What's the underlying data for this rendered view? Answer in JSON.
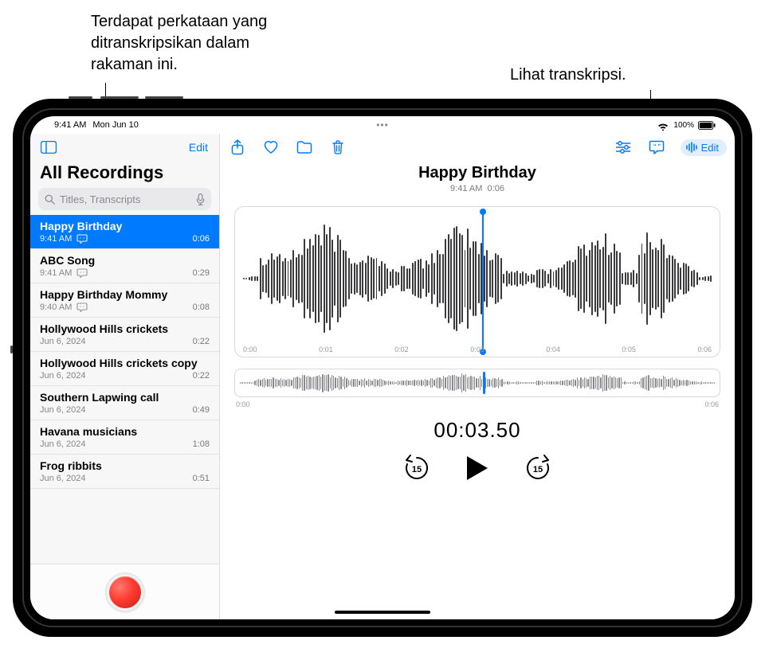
{
  "callouts": {
    "transcript_in_list": "Terdapat perkataan yang ditranskripsikan dalam rakaman ini.",
    "view_transcript": "Lihat transkripsi."
  },
  "status": {
    "time": "9:41 AM",
    "date": "Mon Jun 10"
  },
  "sidebar": {
    "edit": "Edit",
    "title": "All Recordings",
    "search_placeholder": "Titles, Transcripts"
  },
  "recordings": [
    {
      "title": "Happy Birthday",
      "time": "9:41 AM",
      "has_transcript": true,
      "duration": "0:06",
      "selected": true
    },
    {
      "title": "ABC Song",
      "time": "9:41 AM",
      "has_transcript": true,
      "duration": "0:29",
      "selected": false
    },
    {
      "title": "Happy Birthday Mommy",
      "time": "9:40 AM",
      "has_transcript": true,
      "duration": "0:08",
      "selected": false
    },
    {
      "title": "Hollywood Hills crickets",
      "time": "Jun 6, 2024",
      "has_transcript": false,
      "duration": "0:22",
      "selected": false
    },
    {
      "title": "Hollywood Hills crickets copy",
      "time": "Jun 6, 2024",
      "has_transcript": false,
      "duration": "0:22",
      "selected": false
    },
    {
      "title": "Southern Lapwing call",
      "time": "Jun 6, 2024",
      "has_transcript": false,
      "duration": "0:49",
      "selected": false
    },
    {
      "title": "Havana musicians",
      "time": "Jun 6, 2024",
      "has_transcript": false,
      "duration": "1:08",
      "selected": false
    },
    {
      "title": "Frog ribbits",
      "time": "Jun 6, 2024",
      "has_transcript": false,
      "duration": "0:51",
      "selected": false
    }
  ],
  "detail": {
    "title": "Happy Birthday",
    "sub_time": "9:41 AM",
    "sub_duration": "0:06",
    "edit_label": "Edit",
    "ticks": [
      "0:00",
      "0:01",
      "0:02",
      "0:03",
      "0:04",
      "0:05",
      "0:06"
    ],
    "mini_start": "0:00",
    "mini_end": "0:06",
    "current_time": "00:03.50",
    "skip_back_amount": "15",
    "skip_fwd_amount": "15"
  }
}
